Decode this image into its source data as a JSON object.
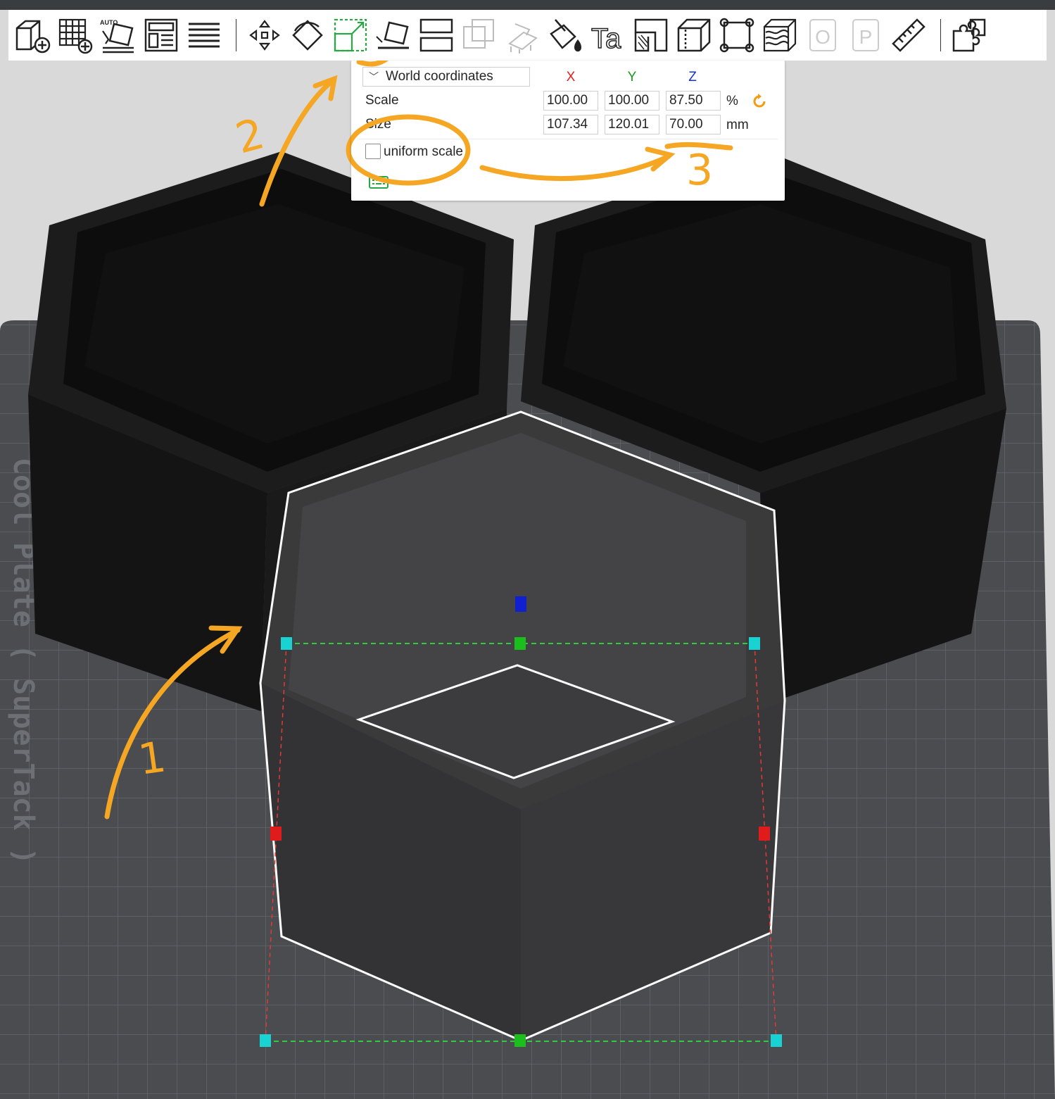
{
  "toolbar": {
    "buttons": [
      {
        "name": "add-object-icon"
      },
      {
        "name": "arrange-grid-icon"
      },
      {
        "name": "auto-orient-icon",
        "text": "AUTO"
      },
      {
        "name": "layout-panels-icon"
      },
      {
        "name": "layers-list-icon"
      },
      {
        "name": "move-icon"
      },
      {
        "name": "rotate-icon"
      },
      {
        "name": "scale-icon"
      },
      {
        "name": "lay-on-face-icon"
      },
      {
        "name": "cut-icon"
      },
      {
        "name": "boolean-icon"
      },
      {
        "name": "support-paint-icon"
      },
      {
        "name": "color-paint-icon"
      },
      {
        "name": "text-emboss-icon",
        "text": "Ta"
      },
      {
        "name": "measure-corner-icon"
      },
      {
        "name": "seam-painting-icon"
      },
      {
        "name": "fit-bounds-icon"
      },
      {
        "name": "variable-layer-icon"
      },
      {
        "name": "placeholder-o-icon",
        "text": "O"
      },
      {
        "name": "placeholder-p-icon",
        "text": "P"
      },
      {
        "name": "ruler-icon"
      },
      {
        "name": "assembly-icon"
      }
    ],
    "accent": "#28a745"
  },
  "scale_panel": {
    "coordinate_system": "World coordinates",
    "axis_labels": {
      "x": "X",
      "y": "Y",
      "z": "Z"
    },
    "axis_colors": {
      "x": "#e02020",
      "y": "#1a9a1a",
      "z": "#1530d0"
    },
    "scale_label": "Scale",
    "size_label": "Size",
    "scale": {
      "x": "100.00",
      "y": "100.00",
      "z": "87.50"
    },
    "size": {
      "x": "107.34",
      "y": "120.01",
      "z": "70.00"
    },
    "scale_unit": "%",
    "size_unit": "mm",
    "uniform_scale_label": "uniform scale",
    "uniform_scale_checked": false,
    "reset_color": "#f39c12"
  },
  "plate": {
    "label": "Cool Plate ( SuperTack )"
  },
  "annotations": {
    "color": "#f5a623",
    "labels": [
      "1",
      "2",
      "3"
    ]
  }
}
